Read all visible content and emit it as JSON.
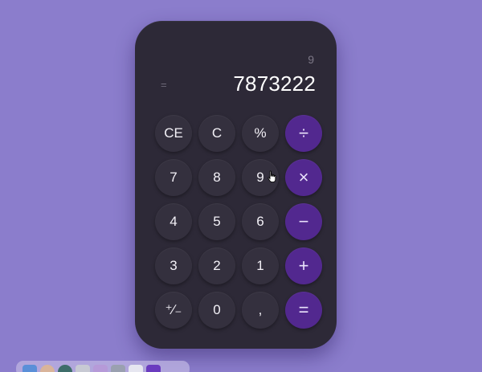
{
  "display": {
    "previous": "9",
    "equals_sign": "=",
    "current": "7873222"
  },
  "keys": [
    {
      "label": "CE",
      "type": "function"
    },
    {
      "label": "C",
      "type": "function"
    },
    {
      "label": "%",
      "type": "function"
    },
    {
      "label": "÷",
      "type": "operator"
    },
    {
      "label": "7",
      "type": "digit"
    },
    {
      "label": "8",
      "type": "digit"
    },
    {
      "label": "9",
      "type": "digit"
    },
    {
      "label": "×",
      "type": "operator"
    },
    {
      "label": "4",
      "type": "digit"
    },
    {
      "label": "5",
      "type": "digit"
    },
    {
      "label": "6",
      "type": "digit"
    },
    {
      "label": "−",
      "type": "operator"
    },
    {
      "label": "3",
      "type": "digit"
    },
    {
      "label": "2",
      "type": "digit"
    },
    {
      "label": "1",
      "type": "digit"
    },
    {
      "label": "+",
      "type": "operator"
    },
    {
      "label": "⁺∕₋",
      "type": "function"
    },
    {
      "label": "0",
      "type": "digit"
    },
    {
      "label": ",",
      "type": "digit"
    },
    {
      "label": "=",
      "type": "operator"
    }
  ],
  "dock": {
    "icons": [
      {
        "name": "finder-icon",
        "color": "#5a8fd8"
      },
      {
        "name": "avatar-icon",
        "color": "#d9b49a"
      },
      {
        "name": "app-circle-icon",
        "color": "#3e6d6a"
      },
      {
        "name": "app-window-icon",
        "color": "#c7c9d3"
      },
      {
        "name": "app-photos-icon",
        "color": "#b69ad8"
      },
      {
        "name": "app-folder-icon",
        "color": "#9aa0b0"
      },
      {
        "name": "app-cat-icon",
        "color": "#e6e6f0"
      },
      {
        "name": "app-calculator-icon",
        "color": "#6a3bbf"
      }
    ]
  },
  "colors": {
    "background": "#8b7dcc",
    "body": "#2d2937",
    "key": "#34303e",
    "operator": "#52288f"
  }
}
